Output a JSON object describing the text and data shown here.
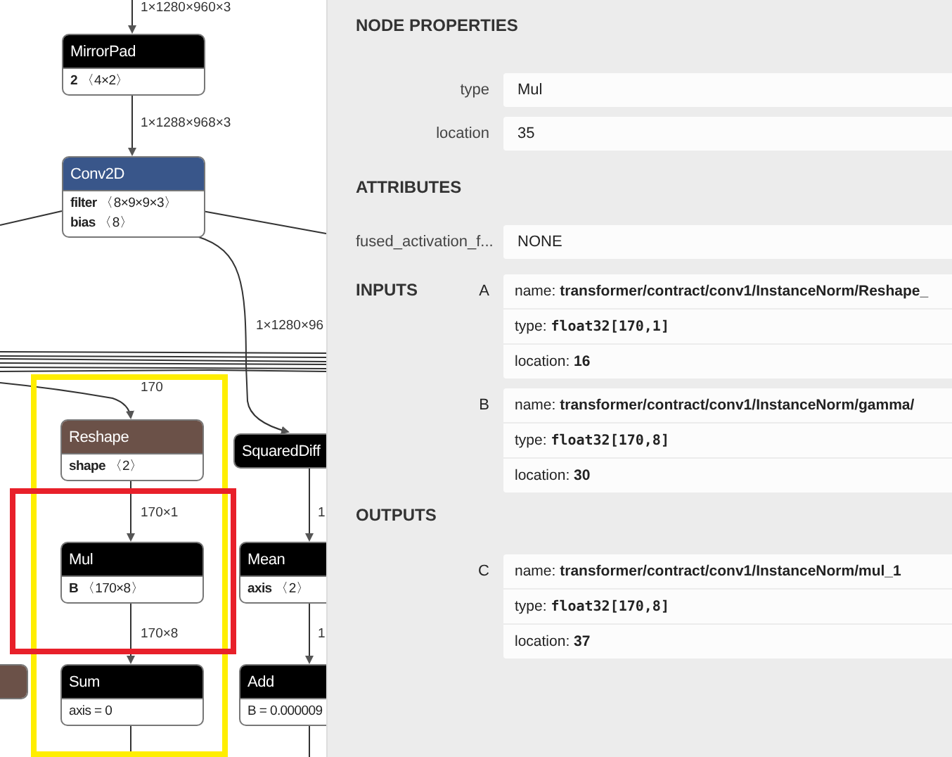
{
  "graph": {
    "nodes": [
      {
        "title": "MirrorPad",
        "color": "#000000",
        "attributes": [
          {
            "name": "2",
            "value": "〈4×2〉"
          }
        ]
      },
      {
        "title": "Conv2D",
        "color": "#39568a",
        "attributes": [
          {
            "name": "filter",
            "value": "〈8×9×9×3〉"
          },
          {
            "name": "bias",
            "value": "〈8〉"
          }
        ]
      },
      {
        "title": "Reshape",
        "color": "#6b5148",
        "attributes": [
          {
            "name": "shape",
            "value": "〈2〉"
          }
        ]
      },
      {
        "title": "SquaredDiff",
        "color": "#000000"
      },
      {
        "title": "Mul",
        "color": "#000000",
        "attributes": [
          {
            "name": "B",
            "value": "〈170×8〉"
          }
        ]
      },
      {
        "title": "Mean",
        "color": "#000000",
        "attributes": [
          {
            "name": "axis",
            "value": "〈2〉"
          }
        ]
      },
      {
        "color": "#6b5148"
      },
      {
        "title": "Sum",
        "color": "#000000",
        "attributes": [
          {
            "text": "axis = 0"
          }
        ]
      },
      {
        "title": "Add",
        "color": "#000000",
        "attributes": [
          {
            "text": "B = 0.000009"
          }
        ]
      }
    ],
    "edge_labels": [
      "1×1280×960×3",
      "1×1288×968×3",
      "1×1280×96",
      "170",
      "170×1",
      "170×8",
      "1",
      "1"
    ]
  },
  "panel": {
    "title": "NODE PROPERTIES",
    "properties": [
      {
        "label": "type",
        "value": "Mul"
      },
      {
        "label": "location",
        "value": "35"
      }
    ],
    "attributes_title": "ATTRIBUTES",
    "attributes": [
      {
        "label": "fused_activation_f...",
        "value": "NONE"
      }
    ],
    "inputs_title": "INPUTS",
    "inputs": [
      {
        "letter": "A",
        "name_label": "name:",
        "name": "transformer/contract/conv1/InstanceNorm/Reshape_",
        "type_label": "type:",
        "type": "float32[170,1]",
        "location_label": "location:",
        "location": "16"
      },
      {
        "letter": "B",
        "name_label": "name:",
        "name": "transformer/contract/conv1/InstanceNorm/gamma/",
        "type_label": "type:",
        "type": "float32[170,8]",
        "location_label": "location:",
        "location": "30"
      }
    ],
    "outputs_title": "OUTPUTS",
    "outputs": [
      {
        "letter": "C",
        "name_label": "name:",
        "name": "transformer/contract/conv1/InstanceNorm/mul_1",
        "type_label": "type:",
        "type": "float32[170,8]",
        "location_label": "location:",
        "location": "37"
      }
    ]
  }
}
